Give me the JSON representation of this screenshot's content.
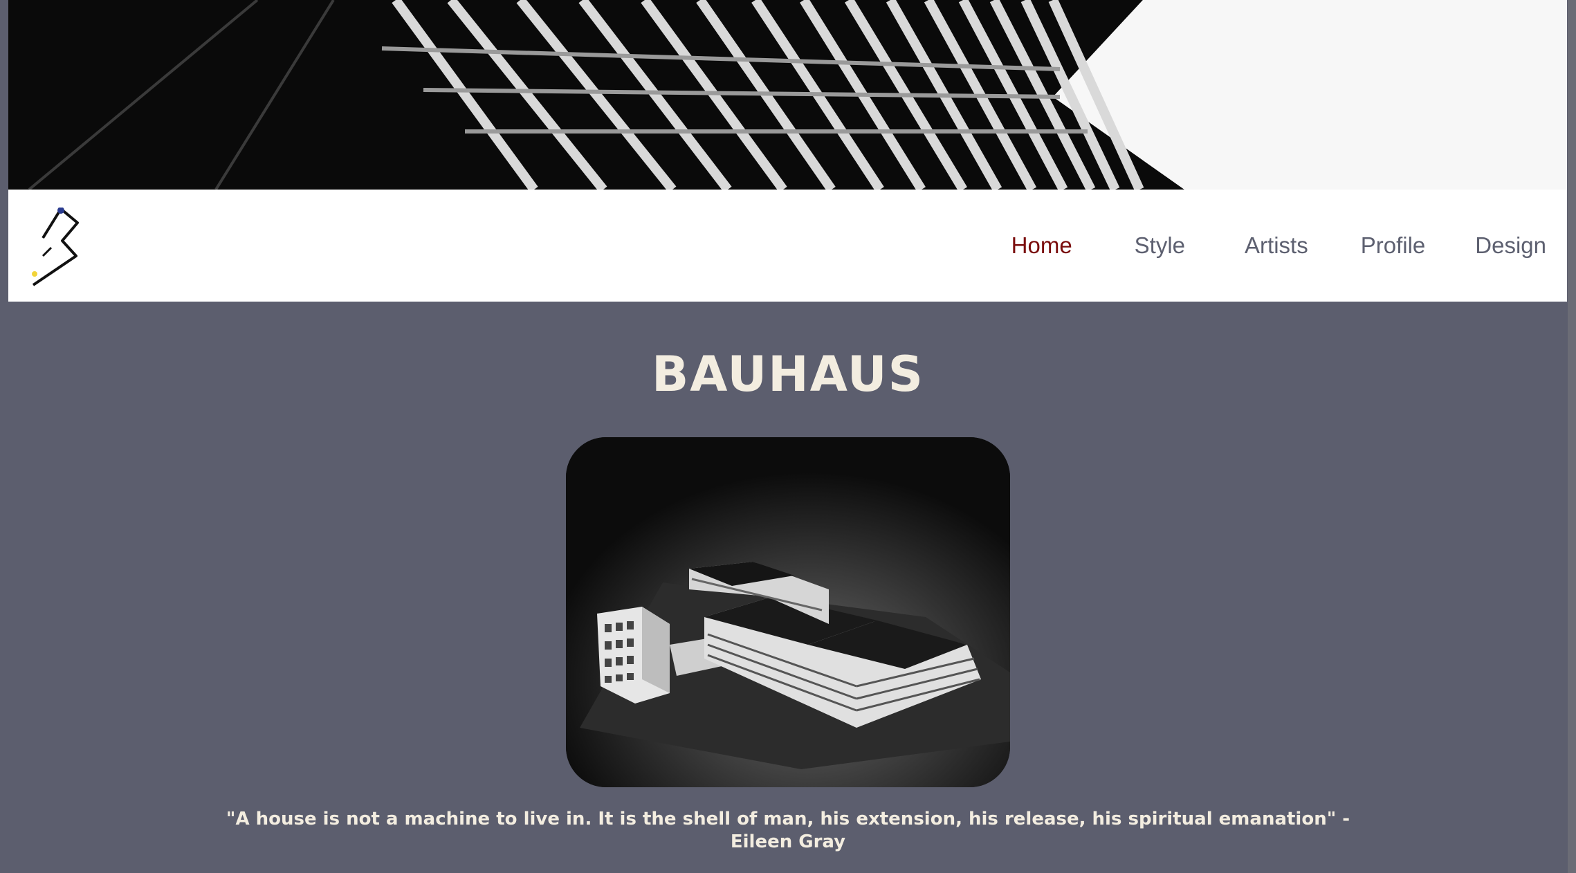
{
  "header": {
    "banner_image": "abstract-architecture-photo",
    "logo": "bauhaus-logo-icon"
  },
  "nav": {
    "items": [
      {
        "label": "Home",
        "active": true
      },
      {
        "label": "Style",
        "active": false
      },
      {
        "label": "Artists",
        "active": false
      },
      {
        "label": "Profile",
        "active": false
      },
      {
        "label": "Design",
        "active": false
      }
    ],
    "active_color": "#7a0d0d",
    "color": "#5d6070"
  },
  "main": {
    "title": "BAUHAUS",
    "image": "bauhaus-building-model-photo",
    "quote_line1": "\"A house is not a machine to live in. It is the shell of man, his extension, his release, his spiritual emanation\" -",
    "quote_line2": "Eileen Gray"
  },
  "colors": {
    "background": "#5c5e6e",
    "text": "#f3ede0"
  }
}
